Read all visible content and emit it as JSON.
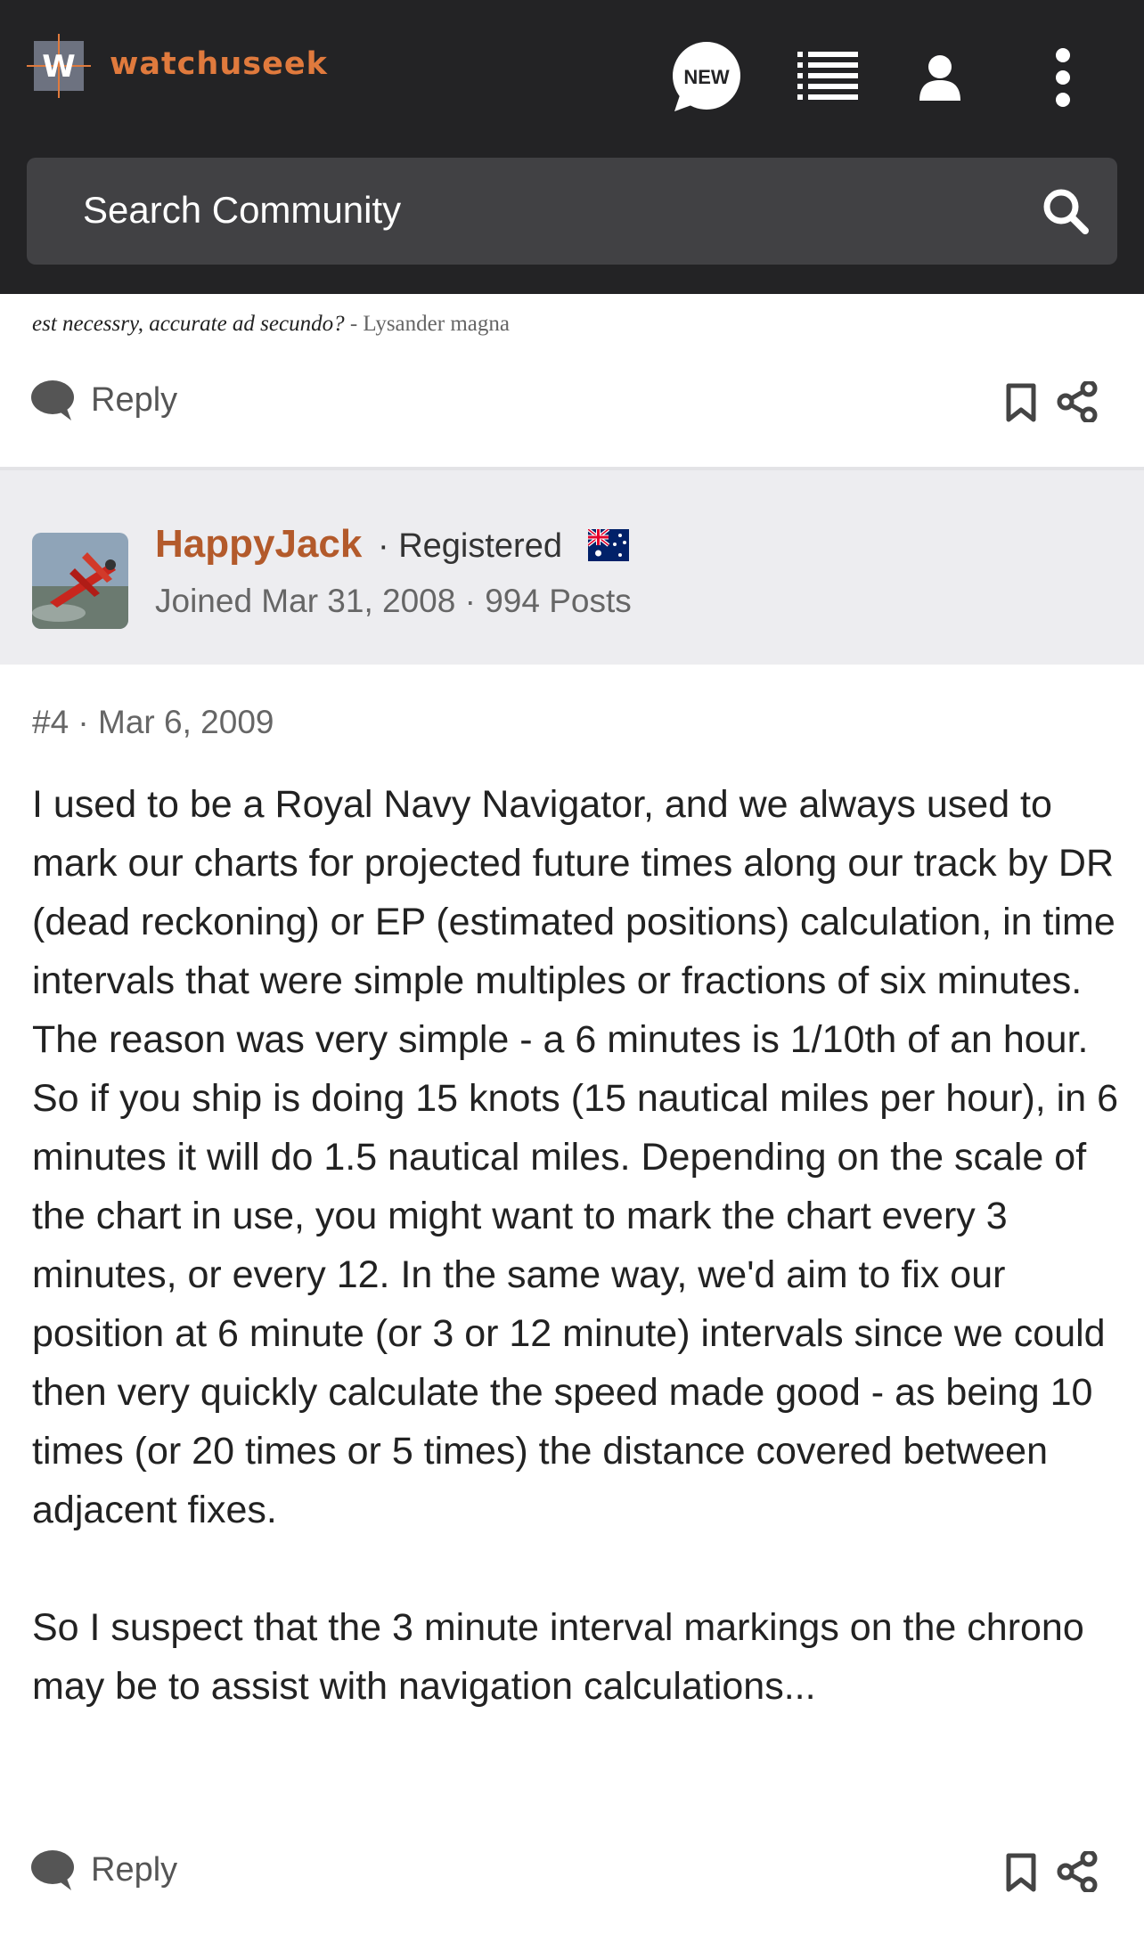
{
  "header": {
    "brand": "watchuseek",
    "logo_letter": "W",
    "new_badge": "NEW",
    "icons": [
      "new-posts-icon",
      "list-icon",
      "user-icon",
      "more-vertical-icon"
    ],
    "colors": {
      "background": "#232325",
      "brand": "#e07a3d"
    }
  },
  "search": {
    "placeholder": "Search Community",
    "icon": "search-icon"
  },
  "previous_post": {
    "signature_text": "est necessry, accurate ad secundo?",
    "signature_author": " - Lysander magna",
    "reply_label": "Reply"
  },
  "post": {
    "author": {
      "name": "HappyJack",
      "role": "· Registered",
      "flag": "australia-flag",
      "joined": "Joined Mar 31, 2008 · 994 Posts"
    },
    "meta": "#4 · Mar 6, 2009",
    "body": [
      "I used to be a Royal Navy Navigator, and we always used to mark our charts for projected future times along our track by DR (dead reckoning) or EP (estimated positions) calculation, in time intervals that were simple multiples or fractions of six minutes. The reason was very simple - a 6 minutes is 1/10th of an hour. So if you ship is doing 15 knots (15 nautical miles per hour), in 6 minutes it will do 1.5 nautical miles. Depending on the scale of the chart in use, you might want to mark the chart every 3 minutes, or every 12. In the same way, we'd aim to fix our position at 6 minute (or 3 or 12 minute) intervals since we could then very quickly calculate the speed made good - as being 10 times (or 20 times or 5 times) the distance covered between adjacent fixes.",
      "So I suspect that the 3 minute interval markings on the chrono may be to assist with navigation calculations..."
    ],
    "reply_label": "Reply",
    "colors": {
      "username": "#b35a2b",
      "banner": "#ededf0"
    }
  }
}
